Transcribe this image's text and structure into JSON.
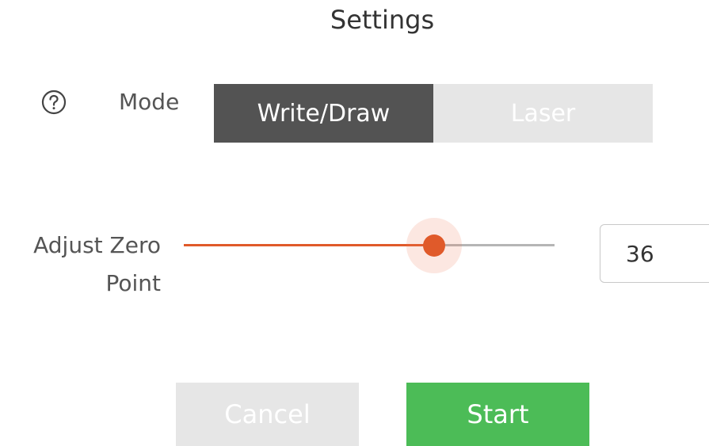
{
  "dialog": {
    "title": "Settings"
  },
  "mode": {
    "help_icon": "question-circle-icon",
    "label": "Mode",
    "options": [
      "Write/Draw",
      "Laser"
    ],
    "selected": "Write/Draw"
  },
  "zero_point": {
    "label": "Adjust Zero Point",
    "value": "36",
    "slider_fraction": 0.675
  },
  "actions": {
    "cancel_label": "Cancel",
    "start_label": "Start"
  },
  "colors": {
    "active_toggle": "#535353",
    "inactive_toggle": "#e6e6e6",
    "slider_accent": "#e05a2a",
    "start_button": "#4cbc57",
    "cancel_button": "#e6e6e6"
  }
}
